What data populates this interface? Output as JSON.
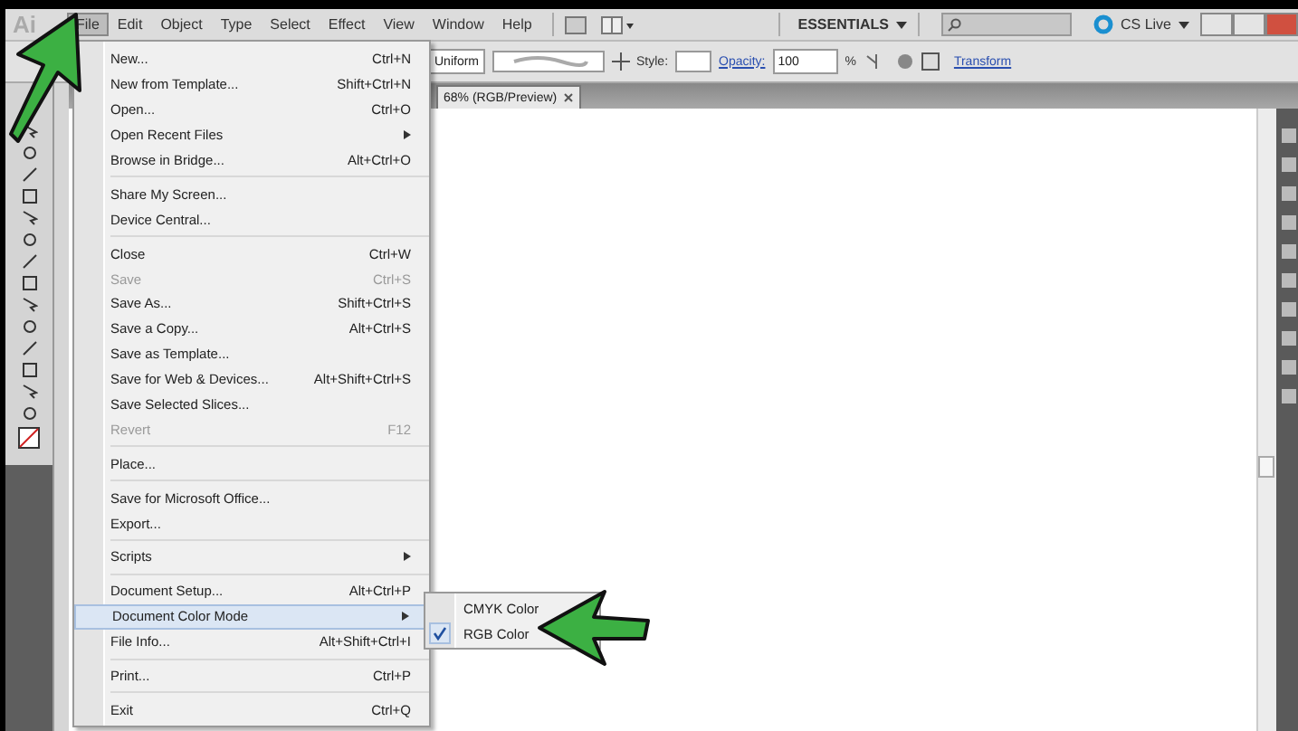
{
  "app_logo": "Ai",
  "menubar": [
    {
      "label": "File",
      "selected": true
    },
    {
      "label": "Edit",
      "selected": false
    },
    {
      "label": "Object",
      "selected": false
    },
    {
      "label": "Type",
      "selected": false
    },
    {
      "label": "Select",
      "selected": false
    },
    {
      "label": "Effect",
      "selected": false
    },
    {
      "label": "View",
      "selected": false
    },
    {
      "label": "Window",
      "selected": false
    },
    {
      "label": "Help",
      "selected": false
    }
  ],
  "workspace": "ESSENTIALS",
  "cs_live": "CS Live",
  "control_bar": {
    "profile": "Uniform",
    "style_label": "Style:",
    "opacity_label": "Opacity:",
    "opacity_value": "100",
    "percent": "%",
    "transform": "Transform"
  },
  "document_tab": "68% (RGB/Preview)",
  "file_menu": [
    {
      "kind": "item",
      "label": "New...",
      "shortcut": "Ctrl+N",
      "disabled": false,
      "selected": false
    },
    {
      "kind": "item",
      "label": "New from Template...",
      "shortcut": "Shift+Ctrl+N",
      "disabled": false,
      "selected": false
    },
    {
      "kind": "item",
      "label": "Open...",
      "shortcut": "Ctrl+O",
      "disabled": false,
      "selected": false
    },
    {
      "kind": "submenu",
      "label": "Open Recent Files",
      "disabled": false,
      "selected": false
    },
    {
      "kind": "item",
      "label": "Browse in Bridge...",
      "shortcut": "Alt+Ctrl+O",
      "disabled": false,
      "selected": false
    },
    {
      "kind": "separator"
    },
    {
      "kind": "item",
      "label": "Share My Screen...",
      "disabled": false,
      "selected": false
    },
    {
      "kind": "item",
      "label": "Device Central...",
      "disabled": false,
      "selected": false
    },
    {
      "kind": "separator"
    },
    {
      "kind": "item",
      "label": "Close",
      "shortcut": "Ctrl+W",
      "disabled": false,
      "selected": false
    },
    {
      "kind": "item",
      "label": "Save",
      "shortcut": "Ctrl+S",
      "disabled": true,
      "selected": false
    },
    {
      "kind": "item",
      "label": "Save As...",
      "shortcut": "Shift+Ctrl+S",
      "disabled": false,
      "selected": false
    },
    {
      "kind": "item",
      "label": "Save a Copy...",
      "shortcut": "Alt+Ctrl+S",
      "disabled": false,
      "selected": false
    },
    {
      "kind": "item",
      "label": "Save as Template...",
      "disabled": false,
      "selected": false
    },
    {
      "kind": "item",
      "label": "Save for Web & Devices...",
      "shortcut": "Alt+Shift+Ctrl+S",
      "disabled": false,
      "selected": false
    },
    {
      "kind": "item",
      "label": "Save Selected Slices...",
      "disabled": false,
      "selected": false
    },
    {
      "kind": "item",
      "label": "Revert",
      "shortcut": "F12",
      "disabled": true,
      "selected": false
    },
    {
      "kind": "separator"
    },
    {
      "kind": "item",
      "label": "Place...",
      "disabled": false,
      "selected": false
    },
    {
      "kind": "separator"
    },
    {
      "kind": "item",
      "label": "Save for Microsoft Office...",
      "disabled": false,
      "selected": false
    },
    {
      "kind": "item",
      "label": "Export...",
      "disabled": false,
      "selected": false
    },
    {
      "kind": "separator"
    },
    {
      "kind": "submenu",
      "label": "Scripts",
      "disabled": false,
      "selected": false
    },
    {
      "kind": "separator"
    },
    {
      "kind": "item",
      "label": "Document Setup...",
      "shortcut": "Alt+Ctrl+P",
      "disabled": false,
      "selected": false
    },
    {
      "kind": "submenu",
      "label": "Document Color Mode",
      "disabled": false,
      "selected": true
    },
    {
      "kind": "item",
      "label": "File Info...",
      "shortcut": "Alt+Shift+Ctrl+I",
      "disabled": false,
      "selected": false
    },
    {
      "kind": "separator"
    },
    {
      "kind": "item",
      "label": "Print...",
      "shortcut": "Ctrl+P",
      "disabled": false,
      "selected": false
    },
    {
      "kind": "separator"
    },
    {
      "kind": "item",
      "label": "Exit",
      "shortcut": "Ctrl+Q",
      "disabled": false,
      "selected": false
    }
  ],
  "color_mode_submenu": [
    {
      "label": "CMYK Color",
      "checked": false
    },
    {
      "label": "RGB Color",
      "checked": true
    }
  ]
}
